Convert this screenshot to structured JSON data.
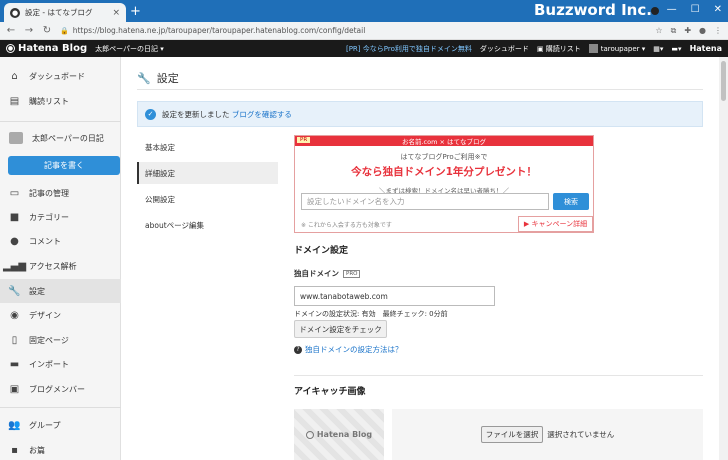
{
  "browser": {
    "tab_title": "設定 - はてなブログ",
    "tab_close": "×",
    "new_tab": "+",
    "url": "https://blog.hatena.ne.jp/taroupaper/taroupaper.hatenablog.com/config/detail",
    "brand": "Buzzword Inc.",
    "minimize": "—",
    "maximize": "☐",
    "close": "✕"
  },
  "topbar": {
    "logo": "Hatena Blog",
    "blog_selector": "太郎ペーパーの日記 ▾",
    "promo": "[PR] 今ならPro利用で独自ドメイン無料",
    "dashboard": "ダッシュボード",
    "reading_list": "購読リスト",
    "user": "taroupaper ▾",
    "hatena": "Hatena"
  },
  "sidebar": {
    "dashboard": "ダッシュボード",
    "reading_list": "購読リスト",
    "blog_name": "太郎ペーパーの日記",
    "write_button": "記事を書く",
    "items": [
      {
        "label": "記事の管理"
      },
      {
        "label": "カテゴリー"
      },
      {
        "label": "コメント"
      },
      {
        "label": "アクセス解析"
      },
      {
        "label": "設定"
      },
      {
        "label": "デザイン"
      },
      {
        "label": "固定ページ"
      },
      {
        "label": "インポート"
      },
      {
        "label": "ブログメンバー"
      }
    ],
    "group": "グループ",
    "account": "お篇"
  },
  "page": {
    "title": "設定",
    "notice_prefix": "設定を更新しました ",
    "notice_link": "ブログを確認する"
  },
  "subnav": [
    {
      "label": "基本設定"
    },
    {
      "label": "詳細設定"
    },
    {
      "label": "公開設定"
    },
    {
      "label": "aboutページ編集"
    }
  ],
  "pr": {
    "tag": "PR",
    "header": "お名前.com × はてなブログ",
    "line1": "はてなブログProご利用※で",
    "line2": "今なら独自ドメイン1年分プレゼント！",
    "line3": "＼まずは検索！ドメイン名は早い者勝ち！／",
    "placeholder": "設定したいドメイン名を入力",
    "search_button": "検索",
    "note": "※ これから入会する方も対象です",
    "campaign": "▶ キャンペーン詳細"
  },
  "domain": {
    "section_title": "ドメイン設定",
    "label": "独自ドメイン",
    "pro_badge": "PRO",
    "value": "www.tanabotaweb.com",
    "status": "ドメインの設定状況: 有効　最終チェック: 0分前",
    "check_button": "ドメイン設定をチェック",
    "help_icon": "?",
    "help_link": "独自ドメインの設定方法は？"
  },
  "eyecatch": {
    "section_title": "アイキャッチ画像",
    "thumb_logo": "Hatena Blog",
    "file_button": "ファイルを選択",
    "file_status": "選択されていません"
  }
}
